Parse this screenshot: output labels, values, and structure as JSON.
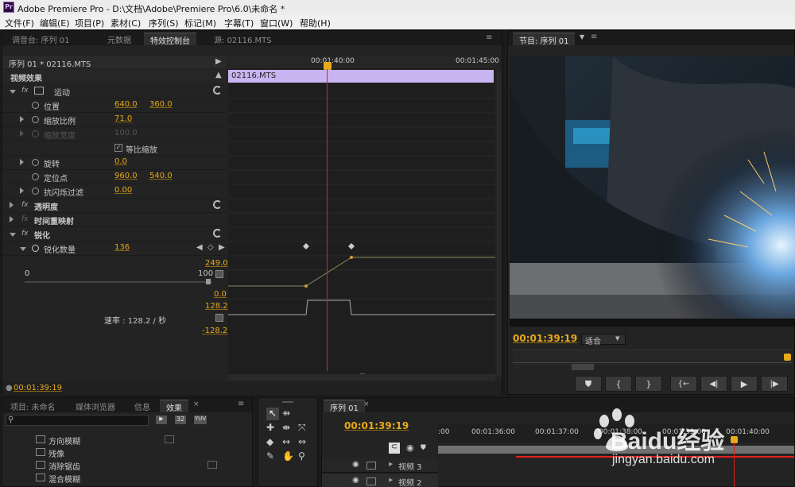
{
  "window": {
    "app_logo": "Pr",
    "title": "Adobe Premiere Pro - D:\\文档\\Adobe\\Premiere Pro\\6.0\\未命名 *"
  },
  "menu": [
    "文件(F)",
    "编辑(E)",
    "项目(P)",
    "素材(C)",
    "序列(S)",
    "标记(M)",
    "字幕(T)",
    "窗口(W)",
    "帮助(H)"
  ],
  "effect_panel": {
    "tabs": [
      "调音台: 序列 01",
      "元数据",
      "特效控制台",
      "源: 02116.MTS"
    ],
    "clip_header": "序列 01 * 02116.MTS",
    "section_title": "视频效果",
    "timecodes": [
      "00:01:40:00",
      "00:01:45:00"
    ],
    "clip_name": "02116.MTS",
    "rows": {
      "motion": "运动",
      "position": {
        "label": "位置",
        "x": "640.0",
        "y": "360.0"
      },
      "scale": {
        "label": "缩放比例",
        "value": "71.0"
      },
      "scale_width": {
        "label": "缩放宽度",
        "value": "100.0"
      },
      "uniform_scale": {
        "label": "等比缩放"
      },
      "rotation": {
        "label": "旋转",
        "value": "0.0"
      },
      "anchor": {
        "label": "定位点",
        "x": "960.0",
        "y": "540.0"
      },
      "anti_flicker": {
        "label": "抗闪烁过滤",
        "value": "0.00"
      },
      "opacity": "透明度",
      "time_remap": "时间重映射",
      "sharpen": "锐化",
      "sharpen_amount": {
        "label": "锐化数量",
        "value": "136"
      }
    },
    "slider": {
      "min": "0",
      "max": "100"
    },
    "graph_values": {
      "top": "249.0",
      "bottom": "0.0",
      "vel_top": "128.2",
      "vel_bottom": "-128.2"
    },
    "rate": "速率 : 128.2 / 秒",
    "current_time": "00:01:39:19"
  },
  "program_monitor": {
    "tab": "节目: 序列 01",
    "timecode": "00:01:39:19",
    "fit": "适合",
    "controls": {
      "marker": "⛊",
      "in": "{",
      "out": "}",
      "go_in": "{←",
      "step_back": "◀|",
      "play": "▶",
      "step_fwd": "|▶"
    }
  },
  "project_panel": {
    "tabs": [
      "项目: 未命名",
      "媒体浏览器",
      "信息",
      "效果"
    ],
    "filter_buttons": [
      "32",
      "YUV"
    ],
    "items": [
      "方向模糊",
      "残像",
      "消除锯齿",
      "混合模糊"
    ]
  },
  "timeline": {
    "tab": "序列 01",
    "timecode": "00:01:39:19",
    "ruler": [
      ":00",
      "00:01:36:00",
      "00:01:37:00",
      "00:01:38:00",
      "00:01:39:00",
      "00:01:40:00"
    ],
    "tracks": [
      "视频 3",
      "视频 2"
    ]
  },
  "watermark": {
    "brand": "Baidu经验",
    "url": "jingyan.baidu.com"
  },
  "colors": {
    "accent_orange": "#e8a91a",
    "playhead_red": "#e02020",
    "clip_purple": "#c8b4f0"
  }
}
